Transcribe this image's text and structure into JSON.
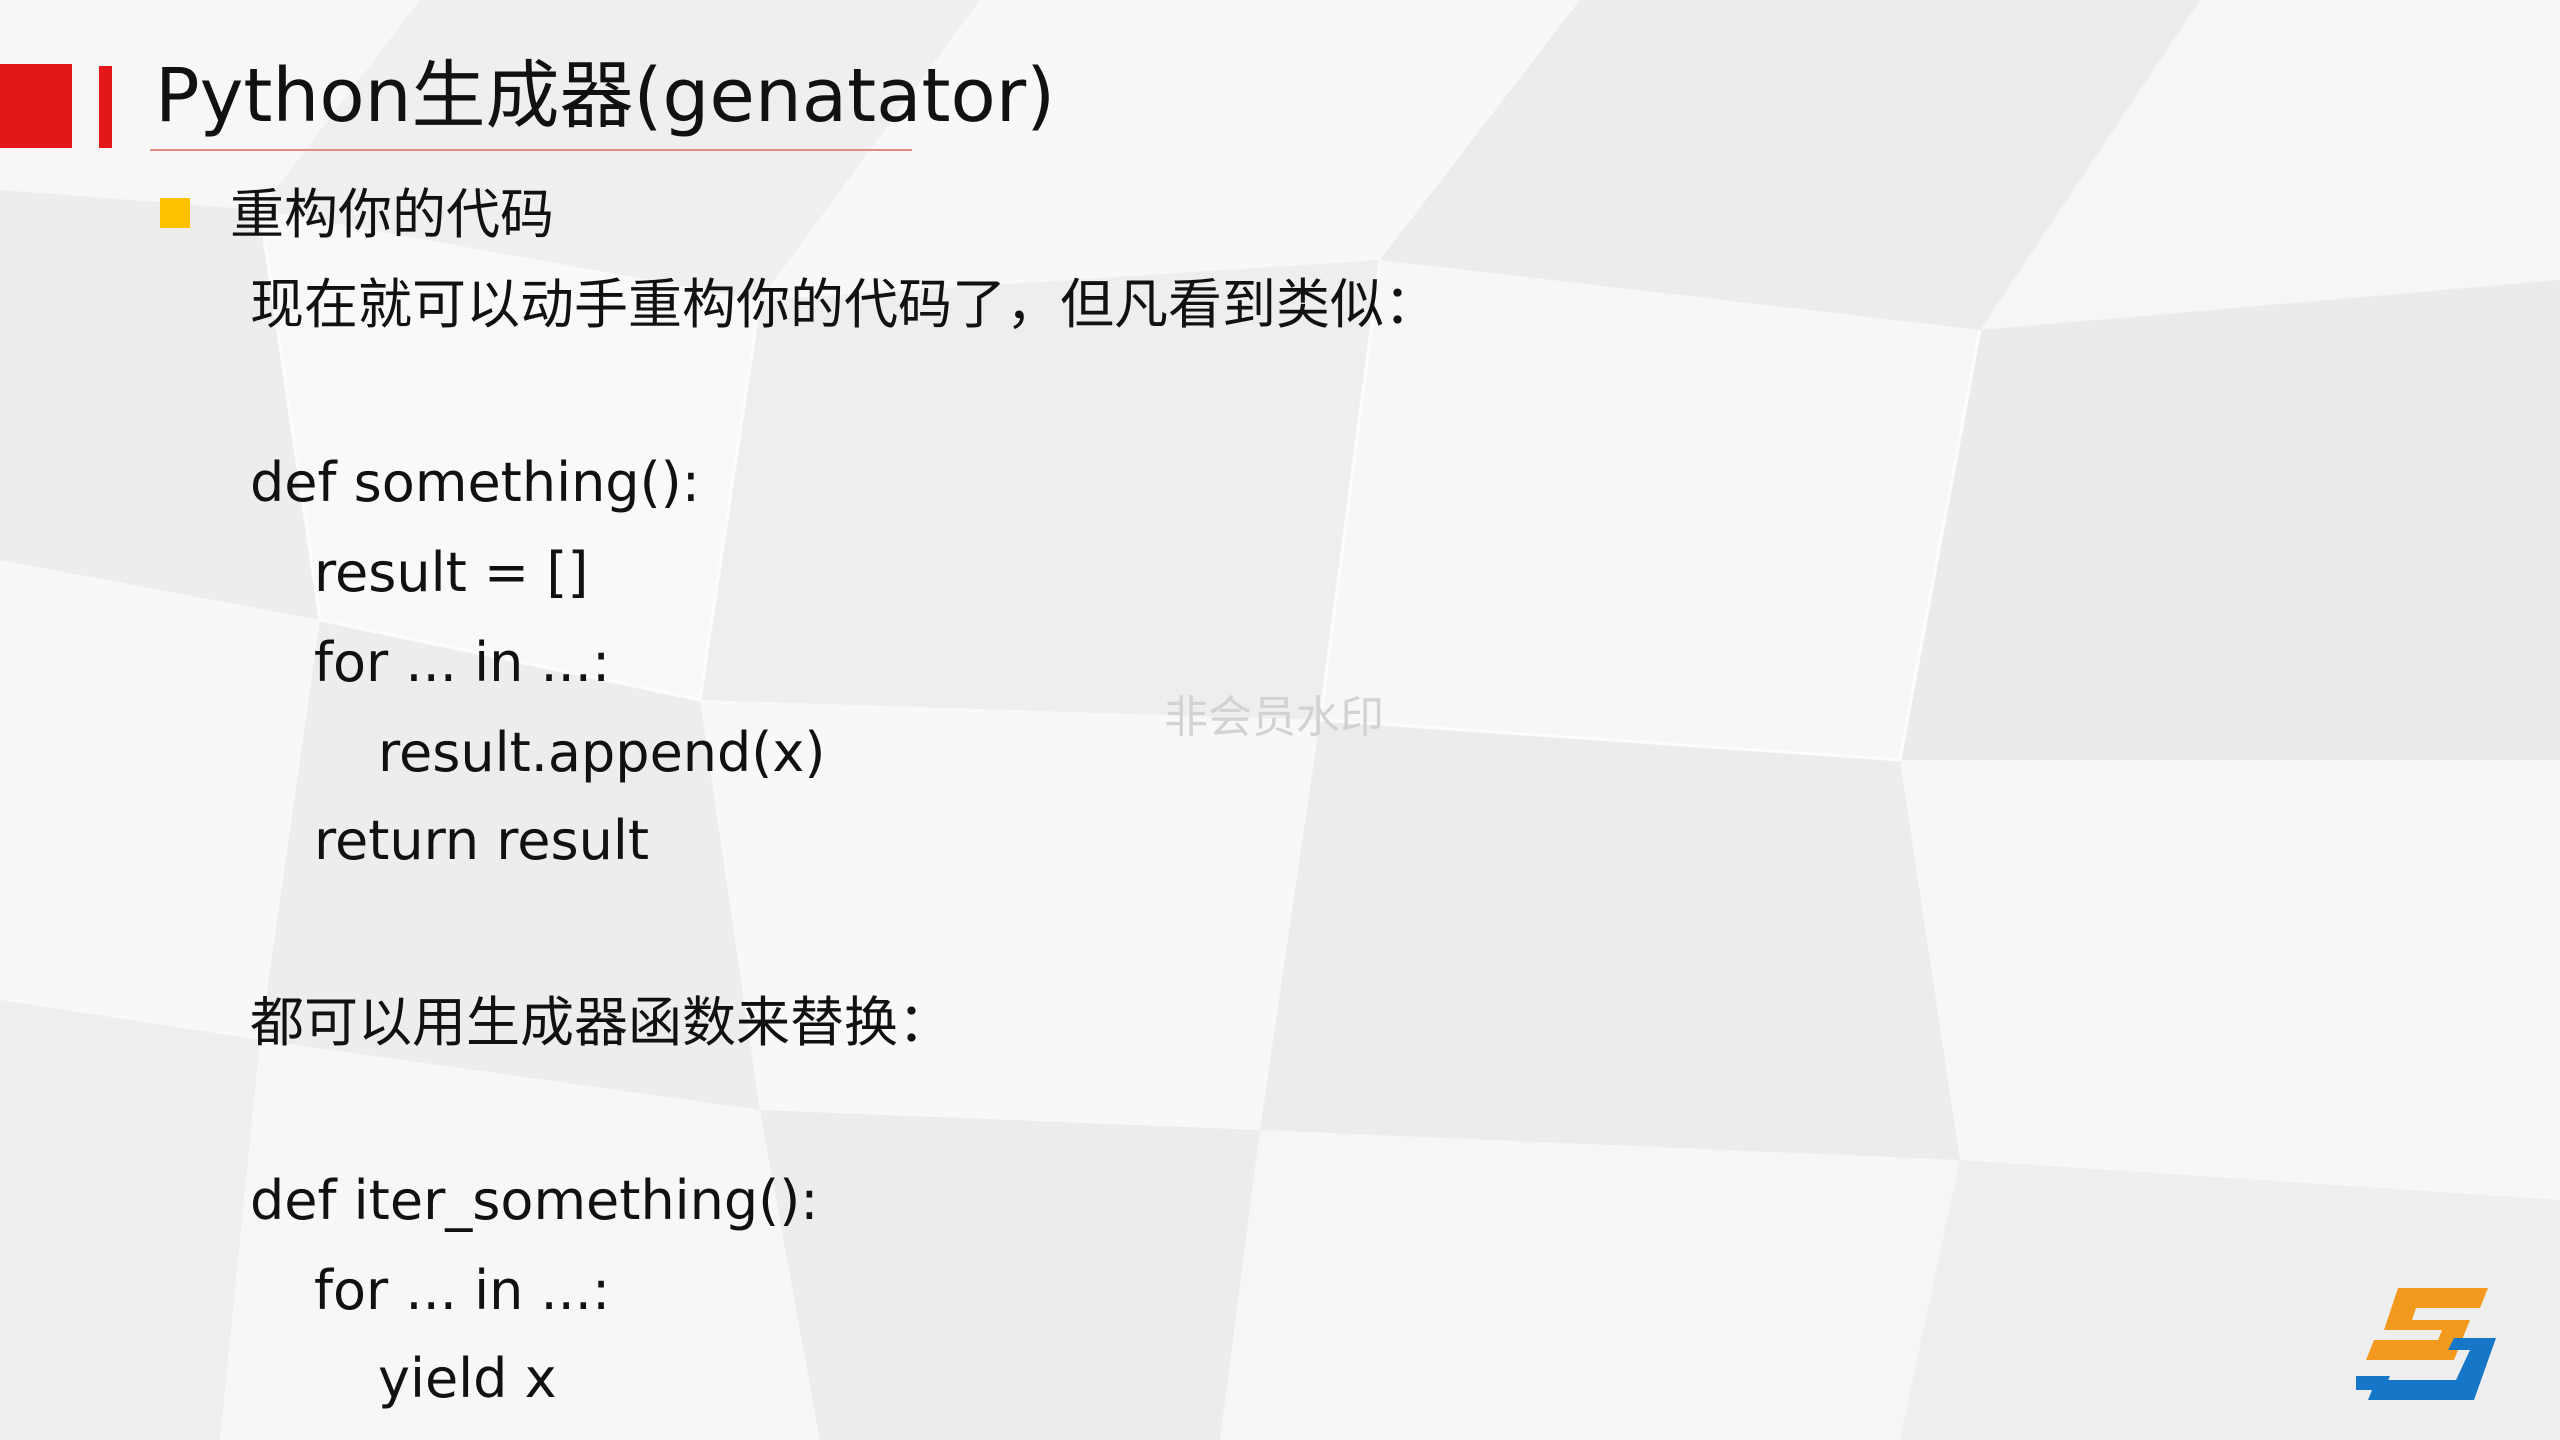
{
  "slide": {
    "title": "Python生成器(genatator)",
    "bullet": "重构你的代码",
    "intro": "现在就可以动手重构你的代码了，但凡看到类似：",
    "code_before": [
      "def something():",
      "result = []",
      "for ... in ...:",
      "result.append(x)",
      "return result"
    ],
    "transition": "都可以用生成器函数来替换：",
    "code_after": [
      "def iter_something():",
      "for ... in ...:",
      "yield x"
    ],
    "watermark": "非会员水印"
  },
  "colors": {
    "accent": "#e3161a",
    "bullet": "#ffc000",
    "logo_orange": "#f39a1e",
    "logo_blue": "#1676c8"
  },
  "icons": {
    "bullet": "square-bullet-icon",
    "logo": "brand-logo-icon"
  }
}
